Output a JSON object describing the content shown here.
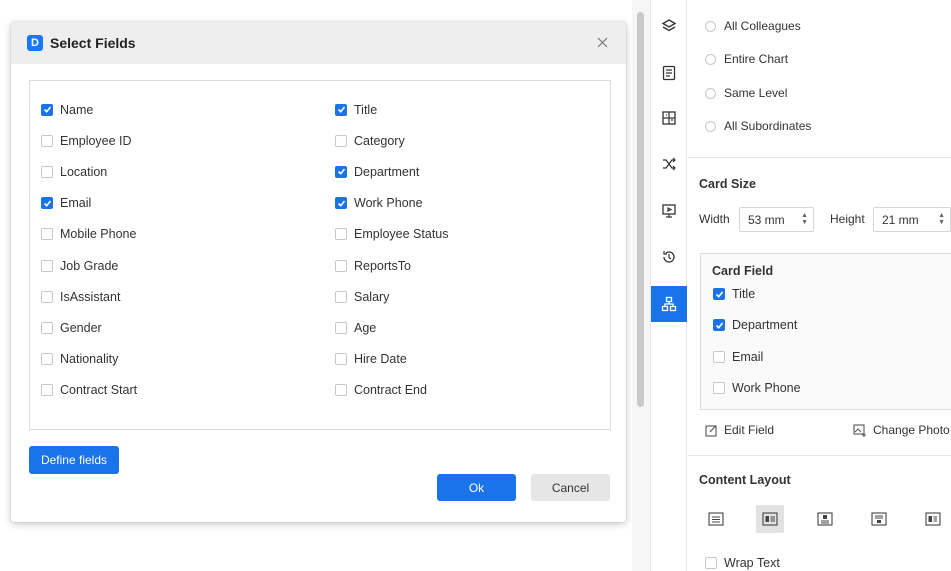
{
  "dialog": {
    "title": "Select Fields",
    "logo_letter": "D",
    "fields_left": [
      {
        "label": "Name",
        "checked": true
      },
      {
        "label": "Employee ID",
        "checked": false
      },
      {
        "label": "Location",
        "checked": false
      },
      {
        "label": "Email",
        "checked": true
      },
      {
        "label": "Mobile Phone",
        "checked": false
      },
      {
        "label": "Job Grade",
        "checked": false
      },
      {
        "label": "IsAssistant",
        "checked": false
      },
      {
        "label": "Gender",
        "checked": false
      },
      {
        "label": "Nationality",
        "checked": false
      },
      {
        "label": "Contract Start",
        "checked": false
      }
    ],
    "fields_right": [
      {
        "label": "Title",
        "checked": true
      },
      {
        "label": "Category",
        "checked": false
      },
      {
        "label": "Department",
        "checked": true
      },
      {
        "label": "Work Phone",
        "checked": true
      },
      {
        "label": "Employee Status",
        "checked": false
      },
      {
        "label": "ReportsTo",
        "checked": false
      },
      {
        "label": "Salary",
        "checked": false
      },
      {
        "label": "Age",
        "checked": false
      },
      {
        "label": "Hire Date",
        "checked": false
      },
      {
        "label": "Contract End",
        "checked": false
      }
    ],
    "define_fields_label": "Define fields",
    "ok_label": "Ok",
    "cancel_label": "Cancel"
  },
  "rail": {
    "icons": [
      "layers-icon",
      "document-list-icon",
      "table-grid-icon",
      "shuffle-icon",
      "presentation-icon",
      "history-icon",
      "org-chart-icon"
    ],
    "active": "org-chart-icon"
  },
  "panel": {
    "select_options": [
      "All Colleagues",
      "Entire Chart",
      "Same Level",
      "All Subordinates"
    ],
    "card_size": {
      "title": "Card Size",
      "width_label": "Width",
      "width_value": "53 mm",
      "height_label": "Height",
      "height_value": "21 mm"
    },
    "card_field": {
      "title": "Card Field",
      "items": [
        {
          "label": "Title",
          "checked": true
        },
        {
          "label": "Department",
          "checked": true
        },
        {
          "label": "Email",
          "checked": false
        },
        {
          "label": "Work Phone",
          "checked": false
        }
      ]
    },
    "edit_field_label": "Edit Field",
    "change_photo_label": "Change Photo",
    "content_layout": {
      "title": "Content Layout",
      "active_index": 1
    },
    "wrap_text_label": "Wrap Text"
  },
  "colors": {
    "accent": "#1a73e8",
    "header_bg": "#eeeeee",
    "cancel_bg": "#e6e6e6"
  }
}
